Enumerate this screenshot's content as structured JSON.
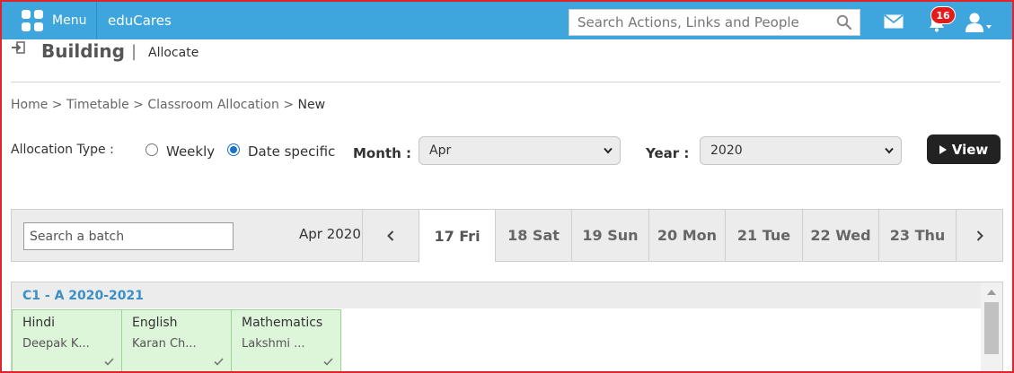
{
  "topbar": {
    "menu_label": "Menu",
    "brand": "eduCares",
    "search_placeholder": "Search Actions, Links and People",
    "notification_count": "16",
    "bg_color": "#3ea6dc",
    "icons": [
      "grid-icon",
      "search-icon",
      "mail-icon",
      "bell-icon",
      "user-icon"
    ]
  },
  "page": {
    "title": "Building",
    "subtitle": "Allocate"
  },
  "breadcrumb": [
    "Home",
    "Timetable",
    "Classroom Allocation",
    "New"
  ],
  "allocation": {
    "type_label": "Allocation Type :",
    "options": [
      "Weekly",
      "Date specific"
    ],
    "selected_option": "Date specific",
    "month_label": "Month :",
    "month_value": "Apr",
    "year_label": "Year :",
    "year_value": "2020",
    "view_label": "View"
  },
  "date_strip": {
    "batch_search_placeholder": "Search a batch",
    "month_year": "Apr 2020",
    "days": [
      "17 Fri",
      "18 Sat",
      "19 Sun",
      "20 Mon",
      "21 Tue",
      "22 Wed",
      "23 Thu"
    ],
    "active_day": "17 Fri"
  },
  "batch": {
    "title": "C1 - A 2020-2021",
    "cards": [
      {
        "subject": "Hindi",
        "teacher": "Deepak K..."
      },
      {
        "subject": "English",
        "teacher": "Karan Ch..."
      },
      {
        "subject": "Mathematics",
        "teacher": "Lakshmi ..."
      }
    ]
  }
}
